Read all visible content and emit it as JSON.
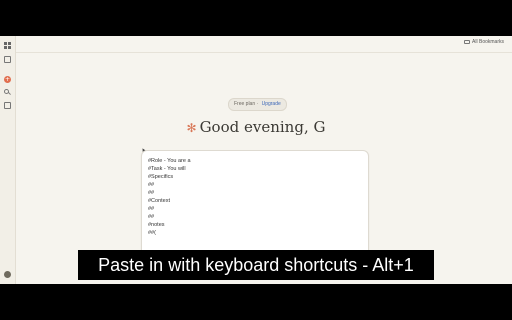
{
  "bookmarks": {
    "all_label": "All Bookmarks"
  },
  "sidebar": {
    "icons": [
      "apps-grid-icon",
      "panel-toggle-icon",
      "new-chat-icon",
      "search-icon",
      "chats-icon",
      "user-avatar"
    ],
    "new_chat_glyph": "+"
  },
  "plan": {
    "text": "Free plan",
    "separator": "·",
    "upgrade": "Upgrade"
  },
  "greeting": {
    "glyph": "✻",
    "text": "Good evening, G"
  },
  "composer": {
    "lines": [
      "#Role - You are a",
      "#Task - You will",
      "#Specifics",
      "##",
      "##",
      "#Context",
      "##",
      "##",
      "#notes",
      "##("
    ]
  },
  "caption": {
    "text": "Paste in with keyboard shortcuts - Alt+1"
  },
  "colors": {
    "accent": "#d97757",
    "link": "#3d68b8",
    "background": "#f6f4ee"
  }
}
